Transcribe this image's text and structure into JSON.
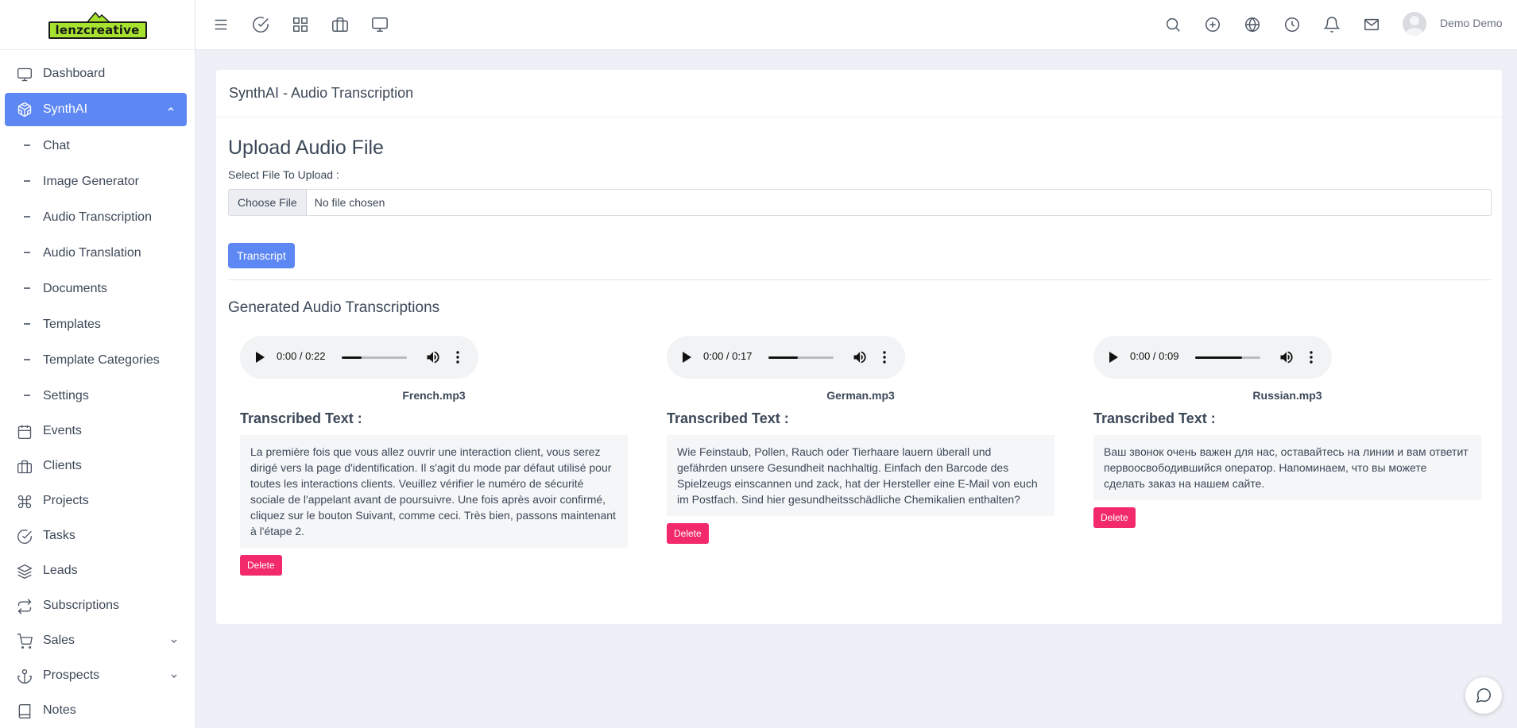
{
  "brand": {
    "name": "lenzcreative",
    "accent": "#a6e22e"
  },
  "colors": {
    "primary": "#5d87f3",
    "danger": "#f2296a",
    "page_bg": "#eef0f7"
  },
  "sidebar": {
    "items": [
      {
        "label": "Dashboard",
        "icon": "monitor-icon"
      },
      {
        "label": "SynthAI",
        "icon": "codesandbox-icon",
        "active": true,
        "expanded": true
      },
      {
        "label": "Events",
        "icon": "calendar-icon"
      },
      {
        "label": "Clients",
        "icon": "briefcase-icon"
      },
      {
        "label": "Projects",
        "icon": "command-icon"
      },
      {
        "label": "Tasks",
        "icon": "check-circle-icon"
      },
      {
        "label": "Leads",
        "icon": "layers-icon"
      },
      {
        "label": "Subscriptions",
        "icon": "repeat-icon"
      },
      {
        "label": "Sales",
        "icon": "cart-icon"
      },
      {
        "label": "Prospects",
        "icon": "anchor-icon"
      },
      {
        "label": "Notes",
        "icon": "book-icon"
      }
    ],
    "subitems": [
      {
        "label": "Chat"
      },
      {
        "label": "Image Generator"
      },
      {
        "label": "Audio Transcription"
      },
      {
        "label": "Audio Translation"
      },
      {
        "label": "Documents"
      },
      {
        "label": "Templates"
      },
      {
        "label": "Template Categories"
      },
      {
        "label": "Settings"
      }
    ]
  },
  "topbar": {
    "left_icons": [
      "menu-icon",
      "check-circle-icon",
      "grid-icon",
      "briefcase-icon",
      "monitor-icon"
    ],
    "right_icons": [
      "search-icon",
      "plus-circle-icon",
      "globe-icon",
      "clock-icon",
      "bell-icon",
      "mail-icon"
    ],
    "user_name": "Demo Demo"
  },
  "page": {
    "card_title": "SynthAI - Audio Transcription",
    "upload_title": "Upload Audio File",
    "file_label": "Select File To Upload :",
    "choose_file": "Choose File",
    "file_status": "No file chosen",
    "transcript_button": "Transcript",
    "generated_title": "Generated Audio Transcriptions"
  },
  "transcriptions": [
    {
      "time": "0:00 / 0:22",
      "progress": 0.3,
      "file_name": "French.mp3",
      "label": "Transcribed Text :",
      "text": "La première fois que vous allez ouvrir une interaction client, vous serez dirigé vers la page d'identification. Il s'agit du mode par défaut utilisé pour toutes les interactions clients. Veuillez vérifier le numéro de sécurité sociale de l'appelant avant de poursuivre. Une fois après avoir confirmé, cliquez sur le bouton Suivant, comme ceci. Très bien, passons maintenant à l'étape 2.",
      "delete": "Delete"
    },
    {
      "time": "0:00 / 0:17",
      "progress": 0.45,
      "file_name": "German.mp3",
      "label": "Transcribed Text :",
      "text": "Wie Feinstaub, Pollen, Rauch oder Tierhaare lauern überall und gefährden unsere Gesundheit nachhaltig. Einfach den Barcode des Spielzeugs einscannen und zack, hat der Hersteller eine E-Mail von euch im Postfach. Sind hier gesundheitsschädliche Chemikalien enthalten?",
      "delete": "Delete"
    },
    {
      "time": "0:00 / 0:09",
      "progress": 0.72,
      "file_name": "Russian.mp3",
      "label": "Transcribed Text :",
      "text": "Ваш звонок очень важен для нас, оставайтесь на линии и вам ответит первоосвободившийся оператор. Напоминаем, что вы можете сделать заказ на нашем сайте.",
      "delete": "Delete"
    }
  ]
}
